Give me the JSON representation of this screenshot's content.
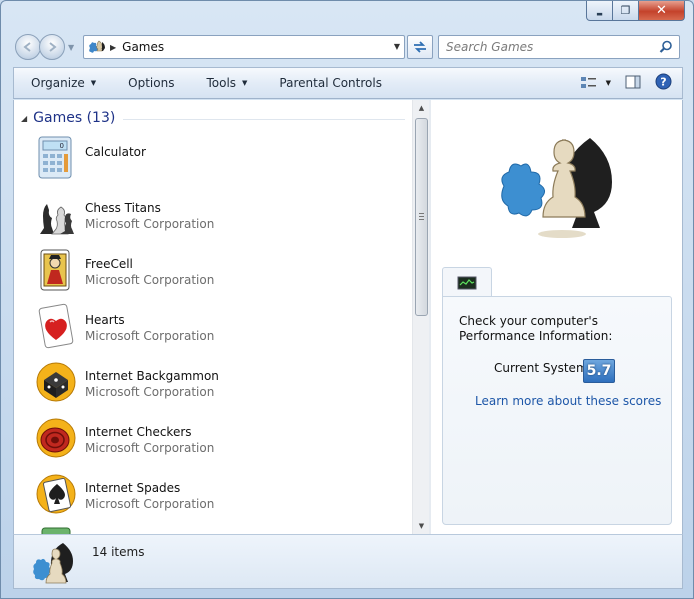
{
  "window": {
    "caption": {
      "minimize": "▬",
      "maximize": "❐",
      "close": "✕"
    }
  },
  "address": {
    "path": "Games",
    "separator": "▶",
    "dropdown": "▼"
  },
  "search": {
    "placeholder": "Search Games"
  },
  "toolbar": {
    "organize": "Organize",
    "options": "Options",
    "tools": "Tools",
    "parental_controls": "Parental Controls",
    "arrow": "▼"
  },
  "group": {
    "title": "Games (13)",
    "toggle": "◢"
  },
  "games": [
    {
      "name": "Calculator",
      "publisher": "",
      "icon": "calculator-icon"
    },
    {
      "name": "Chess Titans",
      "publisher": "Microsoft Corporation",
      "icon": "chess-icon"
    },
    {
      "name": "FreeCell",
      "publisher": "Microsoft Corporation",
      "icon": "freecell-icon"
    },
    {
      "name": "Hearts",
      "publisher": "Microsoft Corporation",
      "icon": "hearts-icon"
    },
    {
      "name": "Internet Backgammon",
      "publisher": "Microsoft Corporation",
      "icon": "backgammon-icon"
    },
    {
      "name": "Internet Checkers",
      "publisher": "Microsoft Corporation",
      "icon": "checkers-icon"
    },
    {
      "name": "Internet Spades",
      "publisher": "Microsoft Corporation",
      "icon": "spades-icon"
    }
  ],
  "scrollbar": {
    "up": "▲",
    "down": "▼"
  },
  "performance": {
    "text": "Check your computer's Performance Information:",
    "current_label": "Current System",
    "score": "5.7",
    "link": "Learn more about these scores"
  },
  "status": {
    "count": "14 items"
  },
  "colors": {
    "accent_blue": "#1e3287",
    "link_blue": "#1e57a8",
    "close_red": "#c4422b",
    "score_blue": "#2d6fbd"
  }
}
